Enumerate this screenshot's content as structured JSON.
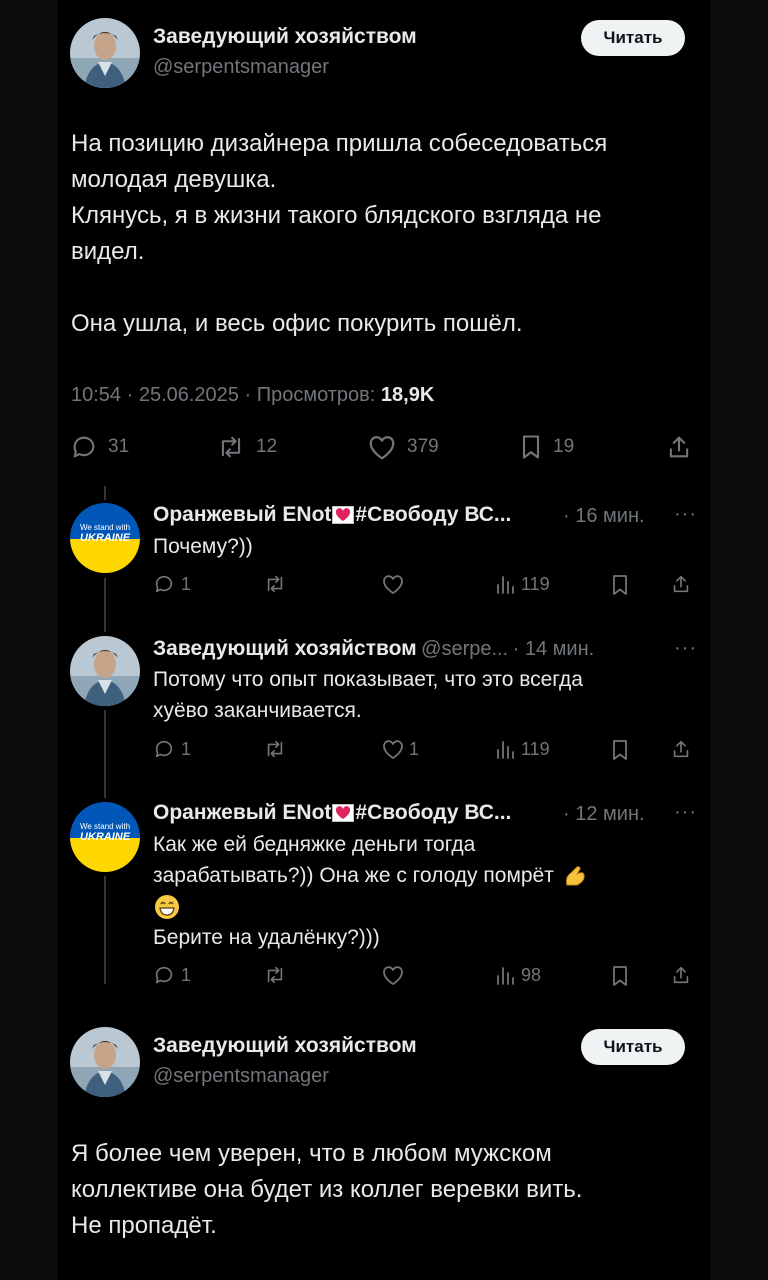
{
  "post": {
    "author_name": "Заведующий хозяйством",
    "author_handle": "@serpentsmanager",
    "follow_label": "Читать",
    "text_lines": [
      "На позицию дизайнера пришла собеседоваться",
      "молодая девушка.",
      "Клянусь, я в жизни такого блядского взгляда не",
      "видел.",
      "",
      "Она ушла, и весь офис покурить пошёл."
    ],
    "meta_prefix": "10:54 · 25.06.2025 · Просмотров: ",
    "views": "18,9K",
    "stats": {
      "replies": "31",
      "reposts": "12",
      "likes": "379",
      "bookmarks": "19"
    }
  },
  "replies": [
    {
      "name_left": "Оранжевый ENot",
      "name_right": "#Свободу ВС...",
      "handle": "",
      "time": "· 16 мин.",
      "lines": [
        "Почему?))"
      ],
      "stats": {
        "replies": "1",
        "reposts": "",
        "likes": "",
        "views": "119"
      }
    },
    {
      "name_left": "Заведующий хозяйством",
      "name_right": "",
      "handle": "@serpe...",
      "time": "· 14 мин.",
      "lines": [
        "Потому что опыт показывает, что это всегда",
        "хуёво заканчивается."
      ],
      "stats": {
        "replies": "1",
        "reposts": "",
        "likes": "1",
        "views": "119"
      }
    },
    {
      "name_left": "Оранжевый ENot",
      "name_right": "#Свободу ВС...",
      "handle": "",
      "time": "· 12 мин.",
      "lines": [
        "Как же ей бедняжке деньги тогда",
        "зарабатывать?)) Она же с голоду помрёт",
        "",
        "Берите на удалёнку?)))"
      ],
      "stats": {
        "replies": "1",
        "reposts": "",
        "likes": "",
        "views": "98"
      }
    }
  ],
  "post2": {
    "author_name": "Заведующий хозяйством",
    "author_handle": "@serpentsmanager",
    "follow_label": "Читать",
    "text_lines": [
      "Я более чем уверен, что в любом мужском",
      "коллективе она будет из коллег веревки вить.",
      "Не пропадёт."
    ]
  },
  "avatar_badge": {
    "line1": "We stand with",
    "line2": "UKRAINE",
    "top": "#0057b7",
    "bottom": "#ffd700"
  },
  "colors": {
    "background": "#000000",
    "text": "#e7e9ea",
    "muted": "#71767b",
    "button": "#eff3f4"
  }
}
